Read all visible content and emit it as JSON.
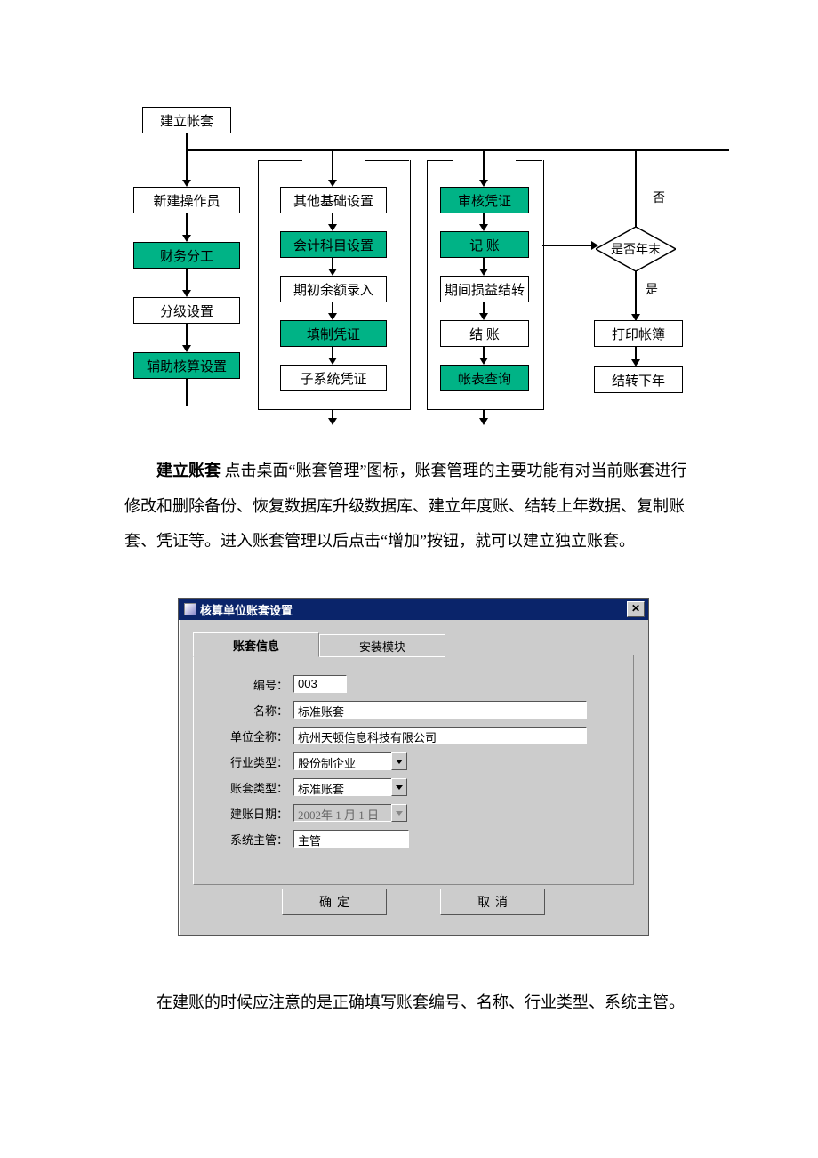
{
  "flow": {
    "col1": [
      "建立帐套",
      "新建操作员",
      "财务分工",
      "分级设置",
      "辅助核算设置"
    ],
    "col2": [
      "其他基础设置",
      "会计科目设置",
      "期初余额录入",
      "填制凭证",
      "子系统凭证"
    ],
    "col3": [
      "审核凭证",
      "记  账",
      "期间损益结转",
      "结  账",
      "帐表查询"
    ],
    "decision": "是否年末",
    "yes": "是",
    "no": "否",
    "col4": [
      "打印帐簿",
      "结转下年"
    ]
  },
  "para1_bold": "建立账套",
  "para1_rest": "  点击桌面“账套管理”图标，账套管理的主要功能有对当前账套进行修改和删除备份、恢复数据库升级数据库、建立年度账、结转上年数据、复制账套、凭证等。进入账套管理以后点击“增加”按钮，就可以建立独立账套。",
  "dialog": {
    "title": "核算单位账套设置",
    "tabs": [
      "账套信息",
      "安装模块"
    ],
    "fields": {
      "id_label": "编号：",
      "id_value": "003",
      "name_label": "名称：",
      "name_value": "标准账套",
      "fullname_label": "单位全称：",
      "fullname_value": "杭州天顿信息科技有限公司",
      "industry_label": "行业类型：",
      "industry_value": "股份制企业",
      "type_label": "账套类型：",
      "type_value": "标准账套",
      "date_label": "建账日期：",
      "date_value": "2002年 1 月 1 日",
      "admin_label": "系统主管：",
      "admin_value": "主管"
    },
    "ok": "确定",
    "cancel": "取消"
  },
  "para2": "在建账的时候应注意的是正确填写账套编号、名称、行业类型、系统主管。"
}
